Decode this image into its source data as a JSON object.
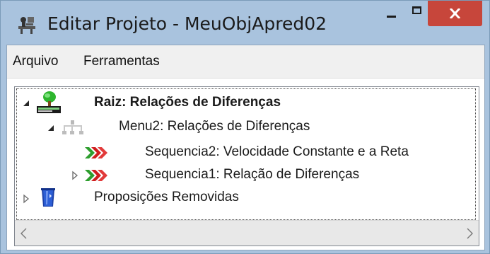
{
  "window": {
    "title": "Editar Projeto - MeuObjApred02",
    "close_color": "#c7463b",
    "titlebar_color": "#a9c3de"
  },
  "menu": {
    "items": [
      "Arquivo",
      "Ferramentas"
    ]
  },
  "tree": {
    "root": {
      "label": "Raiz: Relações de Diferenças",
      "icon": "tree-root-icon",
      "expanded": true
    },
    "menu_node": {
      "label": "Menu2: Relações de Diferenças",
      "icon": "menu-node-icon",
      "expanded": true
    },
    "sequences": [
      {
        "label": "Sequencia2: Velocidade Constante e a Reta",
        "icon": "sequence-arrows-icon",
        "has_children": false
      },
      {
        "label": "Sequencia1: Relação de Diferenças",
        "icon": "sequence-arrows-icon",
        "has_children": true
      }
    ],
    "removed": {
      "label": "Proposições Removidas",
      "icon": "recycle-bin-icon",
      "expanded": false
    }
  }
}
